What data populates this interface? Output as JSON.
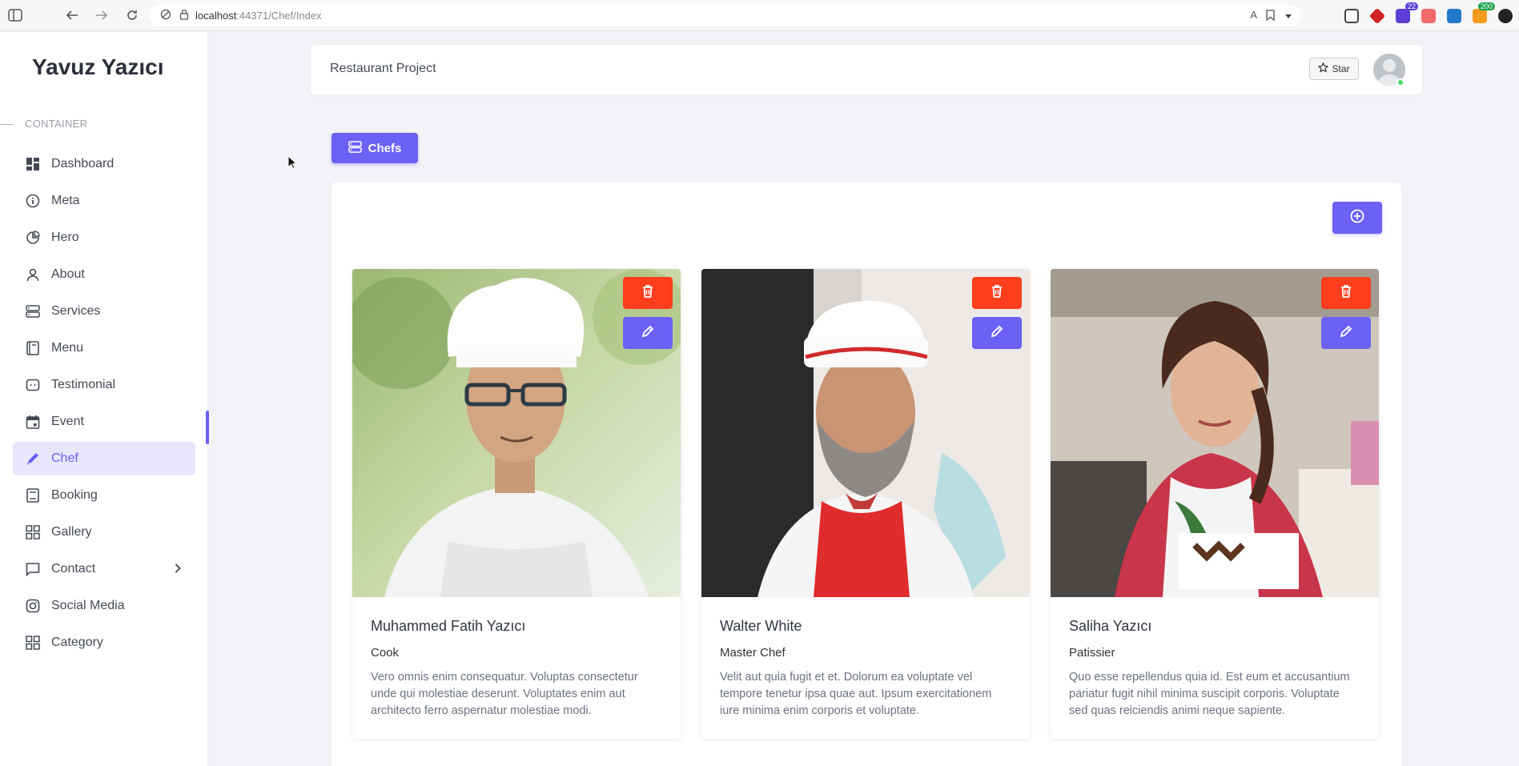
{
  "browser": {
    "url_host": "localhost",
    "url_path": ":44371/Chef/Index",
    "ext_badges": [
      "22",
      "200"
    ]
  },
  "sidebar": {
    "brand": "Yavuz Yazıcı",
    "section_label": "CONTAINER",
    "items": [
      {
        "label": "Dashboard",
        "icon": "dashboard-icon"
      },
      {
        "label": "Meta",
        "icon": "info-icon"
      },
      {
        "label": "Hero",
        "icon": "pie-icon"
      },
      {
        "label": "About",
        "icon": "user-icon"
      },
      {
        "label": "Services",
        "icon": "server-icon"
      },
      {
        "label": "Menu",
        "icon": "book-icon"
      },
      {
        "label": "Testimonial",
        "icon": "chat-bot-icon"
      },
      {
        "label": "Event",
        "icon": "calendar-icon"
      },
      {
        "label": "Chef",
        "icon": "pen-icon",
        "active": true
      },
      {
        "label": "Booking",
        "icon": "booking-icon"
      },
      {
        "label": "Gallery",
        "icon": "grid-icon"
      },
      {
        "label": "Contact",
        "icon": "message-icon",
        "has_children": true
      },
      {
        "label": "Social Media",
        "icon": "instagram-icon"
      },
      {
        "label": "Category",
        "icon": "grid-icon"
      }
    ],
    "accent_color": "#6b61f5"
  },
  "header": {
    "title": "Restaurant Project",
    "star_label": "Star"
  },
  "page": {
    "button_label": "Chefs"
  },
  "chefs": [
    {
      "name": "Muhammed Fatih Yazıcı",
      "role": "Cook",
      "description": "Vero omnis enim consequatur. Voluptas consectetur unde qui molestiae deserunt. Voluptates enim aut architecto ferro aspernatur molestiae modi."
    },
    {
      "name": "Walter White",
      "role": "Master Chef",
      "description": "Velit aut quia fugit et et. Dolorum ea voluptate vel tempore tenetur ipsa quae aut. Ipsum exercitationem iure minima enim corporis et voluptate."
    },
    {
      "name": "Saliha Yazıcı",
      "role": "Patissier",
      "description": "Quo esse repellendus quia id. Est eum et accusantium pariatur fugit nihil minima suscipit corporis. Voluptate sed quas reiciendis animi neque sapiente."
    }
  ],
  "colors": {
    "primary": "#6b61f5",
    "danger": "#ff3e1d"
  }
}
